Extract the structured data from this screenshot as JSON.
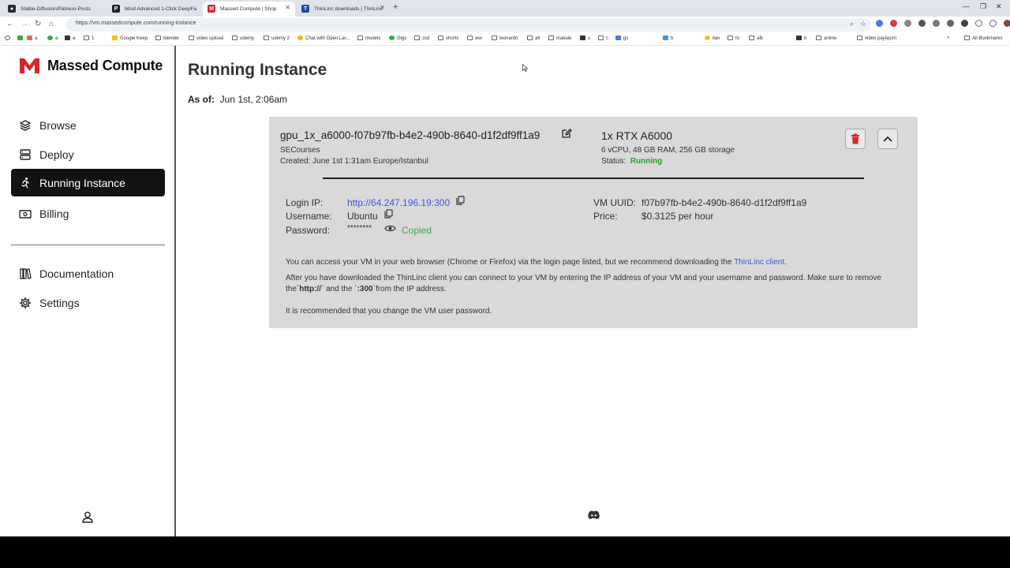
{
  "browser": {
    "tabs": [
      {
        "title": "Stable-Diffusion/Patreon-Posts",
        "favicon": "github-icon",
        "color": "#24292f"
      },
      {
        "title": "Most Advanced 1-Click DeepFa",
        "favicon": "patreon-icon",
        "color": "#222222"
      },
      {
        "title": "Massed Compute | Shop",
        "favicon": "massed-compute-icon",
        "color": "#d4262b"
      },
      {
        "title": "ThinLinc downloads | ThinLinc",
        "favicon": "thinlinc-icon",
        "color": "#1e4aa8"
      }
    ],
    "url": "https://vm.massedcompute.com/running-instance",
    "bookmarks": [
      "a",
      "a",
      "a",
      "1",
      "Google Keep",
      "blender",
      "video upload",
      "udemy",
      "udemy 2",
      "Chat with Open Lar...",
      "models",
      "Gigs",
      "ssd",
      "shorts",
      "ww",
      "leonardo",
      "alt",
      "makale",
      "s",
      "c",
      "gs",
      "b",
      "ilan",
      "fo",
      "afk",
      "b",
      "anime",
      "video paylaşım",
      "All Bookmarks"
    ]
  },
  "sidebar": {
    "brand": "Massed Compute",
    "brand_color": "#d4262b",
    "items": [
      {
        "label": "Browse",
        "icon": "layers-icon"
      },
      {
        "label": "Deploy",
        "icon": "server-icon"
      },
      {
        "label": "Running Instance",
        "icon": "running-icon",
        "active": true
      },
      {
        "label": "Billing",
        "icon": "cash-icon"
      },
      {
        "label": "Documentation",
        "icon": "books-icon"
      },
      {
        "label": "Settings",
        "icon": "gear-icon"
      }
    ]
  },
  "main": {
    "title": "Running Instance",
    "asof_label": "As of:",
    "asof_value": "Jun 1st, 2:06am"
  },
  "instance": {
    "name": "gpu_1x_a6000-f07b97fb-b4e2-490b-8640-d1f2df9ff1a9",
    "owner": "SECourses",
    "created": "Created: June 1st 1:31am Europe/Istanbul",
    "gpu": "1x RTX A6000",
    "specs": "6 vCPU, 48 GB RAM, 256 GB storage",
    "status_label": "Status:",
    "status_value": "Running",
    "login_ip_label": "Login IP:",
    "login_ip": "http://64.247.196.19:300",
    "username_label": "Username:",
    "username": "Ubuntu",
    "password_label": "Password:",
    "password": "********",
    "copied": "Copied",
    "vm_uuid_label": "VM UUID:",
    "vm_uuid": "f07b97fb-b4e2-490b-8640-d1f2df9ff1a9",
    "price_label": "Price:",
    "price": "$0.3125 per hour",
    "para1_pre": "You can access your VM in your web browser (Chrome or Firefox) via the login page listed, but we recommend downloading the ",
    "para1_link": "ThinLinc client",
    "para1_post": ".",
    "para2_a": "After you have downloaded the ThinLinc client you can connect to your VM by entering the IP address of your VM and your username and password. Make sure to remove the`",
    "para2_b": "http://",
    "para2_c": "` and the `",
    "para2_d": ":300",
    "para2_e": "`from the IP address.",
    "para3": "It is recommended that you change the VM user password."
  }
}
